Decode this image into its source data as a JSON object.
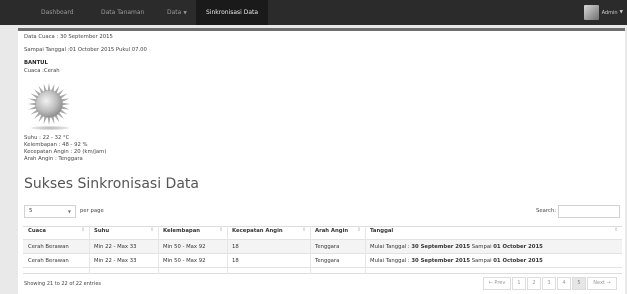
{
  "navbar": {
    "items": [
      "Dashboard",
      "Data Tanaman",
      "Data",
      "Sinkronisasi Data"
    ],
    "user": "Admin"
  },
  "info": {
    "data_cuaca": "Data Cuaca : 30 September 2015",
    "sampai": "Sampai Tanggal :01 October 2015 Pukul 07.00",
    "location": "BANTUL",
    "cuaca": "Cuaca :Cerah",
    "suhu": "Suhu : 22 - 32 °C",
    "kelembapan": "Kelembapan : 48 - 92 %",
    "angin": "Kecepatan Angin : 20 (km/jam)",
    "arah": "Arah Angin : Tenggara"
  },
  "heading": "Sukses Sinkronisasi Data",
  "controls": {
    "per_page_value": "5",
    "per_page_label": "per page",
    "search_label": "Search:"
  },
  "table": {
    "headers": [
      "Cuaca",
      "Suhu",
      "Kelembapan",
      "Kecepatan Angin",
      "Arah Angin",
      "Tanggal"
    ],
    "rows": [
      {
        "cuaca": "Cerah Berawan",
        "suhu": "Min 22 - Max 33",
        "kelembapan": "Min 50 - Max 92",
        "angin": "18",
        "arah": "Tenggara",
        "tgl_a": "Mulai Tanggal : ",
        "tgl_b": "30 September 2015",
        "tgl_c": " Sampai ",
        "tgl_d": "01 October 2015"
      },
      {
        "cuaca": "Cerah Berawan",
        "suhu": "Min 22 - Max 33",
        "kelembapan": "Min 50 - Max 92",
        "angin": "18",
        "arah": "Tenggara",
        "tgl_a": "Mulai Tanggal : ",
        "tgl_b": "30 September 2015",
        "tgl_c": " Sampai ",
        "tgl_d": "01 October 2015"
      }
    ]
  },
  "footer": {
    "showing": "Showing 21 to 22 of 22 entries",
    "pages": [
      "← Prev",
      "1",
      "2",
      "3",
      "4",
      "5",
      "Next →"
    ],
    "current_page": "5"
  }
}
